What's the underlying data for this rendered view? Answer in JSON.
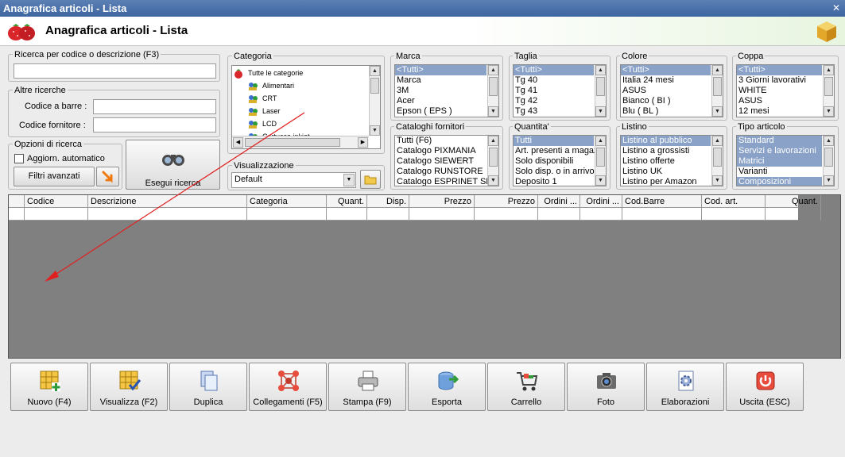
{
  "window": {
    "title": "Anagrafica articoli  - Lista",
    "close_glyph": "✕"
  },
  "header": {
    "title": "Anagrafica articoli  - Lista"
  },
  "search": {
    "code_desc_label": "Ricerca per codice o descrizione (F3)",
    "code_desc_value": "",
    "other_label": "Altre ricerche",
    "barcode_label": "Codice a barre :",
    "barcode_value": "",
    "supplier_code_label": "Codice fornitore :",
    "supplier_code_value": "",
    "options_label": "Opzioni di ricerca",
    "auto_update_label": "Aggiorn. automatico",
    "advanced_filters_label": "Filtri avanzati",
    "execute_label": "Esegui ricerca"
  },
  "category": {
    "label": "Categoria",
    "items": [
      "Tutte le categorie",
      "Alimentari",
      "CRT",
      "Laser",
      "LCD",
      "Cartucce inkjet"
    ]
  },
  "view": {
    "label": "Visualizzazione",
    "value": "Default"
  },
  "filters": {
    "marca": {
      "label": "Marca",
      "items": [
        "<Tutti>",
        "Marca",
        "3M",
        "Acer",
        "Epson ( EPS )"
      ],
      "selected": [
        0
      ]
    },
    "taglia": {
      "label": "Taglia",
      "items": [
        "<Tutti>",
        "Tg 40",
        "Tg 41",
        "Tg 42",
        "Tg 43"
      ],
      "selected": [
        0
      ]
    },
    "colore": {
      "label": "Colore",
      "items": [
        "<Tutti>",
        "Italia 24 mesi",
        "ASUS",
        "Bianco ( BI )",
        "Blu ( BL )"
      ],
      "selected": [
        0
      ]
    },
    "coppa": {
      "label": "Coppa",
      "items": [
        "<Tutti>",
        "3 Giorni lavorativi",
        "WHITE",
        "ASUS",
        "12 mesi"
      ],
      "selected": [
        0
      ]
    },
    "cataloghi": {
      "label": "Cataloghi fornitori",
      "items": [
        "Tutti (F6)",
        "Catalogo PIXMANIA",
        "Catalogo SIEWERT",
        "Catalogo RUNSTORE",
        "Catalogo ESPRINET SPA"
      ],
      "selected": []
    },
    "quantita": {
      "label": "Quantita'",
      "items": [
        "Tutti",
        "Art. presenti a magazzino",
        "Solo disponibili",
        "Solo disp. o in arrivo",
        "Deposito 1"
      ],
      "selected": [
        0
      ]
    },
    "listino": {
      "label": "Listino",
      "items": [
        "Listino al pubblico",
        "Listino a grossisti",
        "Listino offerte",
        "Listino UK",
        "Listino per Amazon"
      ],
      "selected": [
        0
      ]
    },
    "tipo": {
      "label": "Tipo articolo",
      "items": [
        "Standard",
        "Servizi e lavorazioni",
        "Matrici",
        "Varianti",
        "Composizioni"
      ],
      "selected": [
        0,
        1,
        2,
        4
      ]
    }
  },
  "grid": {
    "columns": [
      "",
      "Codice",
      "Descrizione",
      "Categoria",
      "Quant.",
      "Disp.",
      "Prezzo",
      "Prezzo",
      "Ordini ...",
      "Ordini ...",
      "Cod.Barre",
      "Cod. art.",
      "Quant."
    ]
  },
  "toolbar": {
    "buttons": [
      {
        "name": "nuovo-button",
        "label": "Nuovo (F4)",
        "icon": "grid-plus-icon"
      },
      {
        "name": "visualizza-button",
        "label": "Visualizza (F2)",
        "icon": "grid-check-icon"
      },
      {
        "name": "duplica-button",
        "label": "Duplica",
        "icon": "duplicate-icon"
      },
      {
        "name": "collegamenti-button",
        "label": "Collegamenti (F5)",
        "icon": "molecule-icon"
      },
      {
        "name": "stampa-button",
        "label": "Stampa (F9)",
        "icon": "printer-icon"
      },
      {
        "name": "esporta-button",
        "label": "Esporta",
        "icon": "database-export-icon"
      },
      {
        "name": "carrello-button",
        "label": "Carrello",
        "icon": "cart-icon"
      },
      {
        "name": "foto-button",
        "label": "Foto",
        "icon": "camera-icon"
      },
      {
        "name": "elaborazioni-button",
        "label": "Elaborazioni",
        "icon": "gear-doc-icon"
      },
      {
        "name": "uscita-button",
        "label": "Uscita (ESC)",
        "icon": "exit-icon"
      }
    ]
  },
  "colors": {
    "title_bar": "#3d65a0",
    "selection": "#8aa2c8",
    "grid_bg": "#808080",
    "annotation_arrow": "#e02020"
  }
}
